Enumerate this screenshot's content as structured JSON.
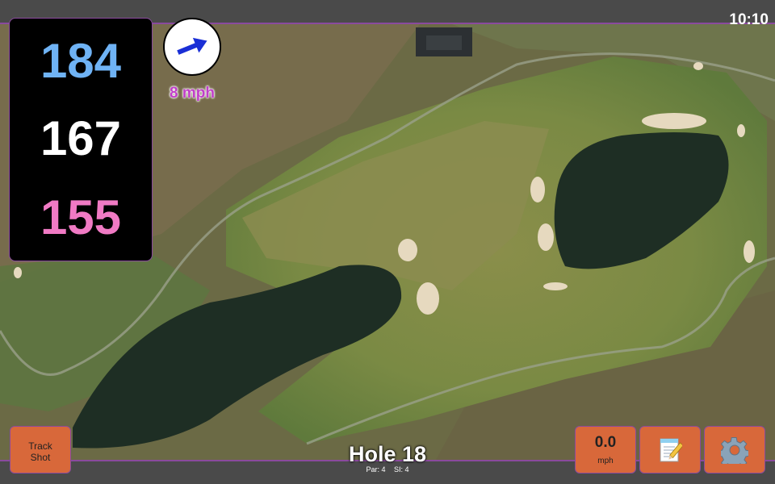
{
  "status": {
    "time": "10:10"
  },
  "distances": {
    "back": "184",
    "center": "167",
    "front": "155",
    "colors": {
      "back": "#6fb3f5",
      "center": "#ffffff",
      "front": "#f07ac4"
    }
  },
  "wind": {
    "speed_label": "8 mph",
    "direction_icon": "arrow-icon",
    "arrow_color": "#1a2fd6"
  },
  "buttons": {
    "track_line1": "Track",
    "track_line2": "Shot",
    "speed_value": "0.0",
    "speed_unit": "mph",
    "notes_icon": "notepad-icon",
    "settings_icon": "gear-icon"
  },
  "hole": {
    "title": "Hole 18",
    "par_label": "Par: 4",
    "si_label": "SI: 4"
  },
  "theme": {
    "accent": "#8a4a9e",
    "button": "#d8683a",
    "bar": "#4a4a4a"
  }
}
